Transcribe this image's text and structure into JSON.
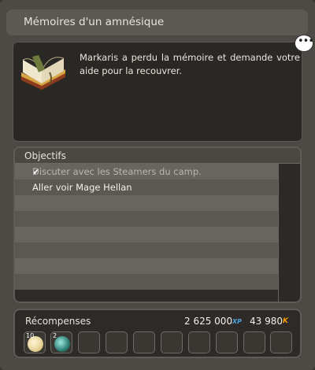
{
  "window": {
    "title": "Mémoires d'un amnésique"
  },
  "description": {
    "text": "Markaris a perdu la mémoire et demande votre aide pour la recouvrer."
  },
  "objectives": {
    "header": "Objectifs",
    "items": [
      {
        "label": "Discuter avec les Steamers du camp.",
        "done": true
      },
      {
        "label": "Aller voir Mage Hellan",
        "done": false
      }
    ]
  },
  "rewards": {
    "header": "Récompenses",
    "xp": "2 625 000",
    "xp_unit": "XP",
    "kamas": "43 980",
    "kamas_unit": "K",
    "items": [
      {
        "quantity": "10",
        "icon": "orb-icon"
      },
      {
        "quantity": "2",
        "icon": "crystal-icon"
      }
    ]
  },
  "colors": {
    "xp": "#4aa0e0",
    "kamas": "#ff9c00"
  }
}
